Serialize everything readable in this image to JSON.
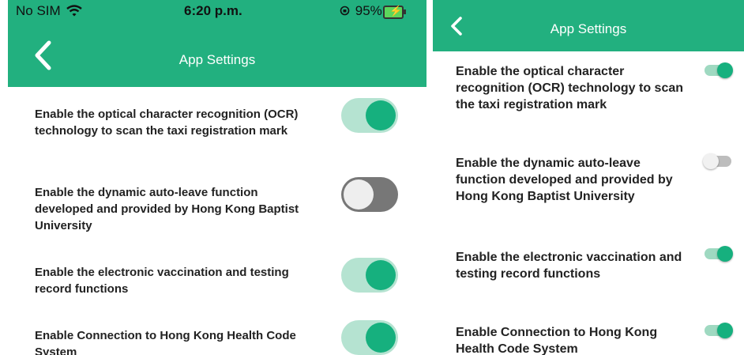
{
  "ios": {
    "status_bar": {
      "carrier": "No SIM",
      "time": "6:20 p.m.",
      "battery": "95%"
    },
    "header": {
      "title": "App Settings"
    },
    "settings": [
      {
        "label": "Enable the optical character recognition (OCR) technology to scan the taxi registration mark",
        "enabled": true
      },
      {
        "label": "Enable the dynamic auto-leave function developed and provided by Hong Kong Baptist University",
        "enabled": false
      },
      {
        "label": "Enable the electronic vaccination and testing record functions",
        "enabled": true
      },
      {
        "label": "Enable Connection to Hong Kong Health Code System",
        "enabled": true
      }
    ]
  },
  "android": {
    "header": {
      "title": "App Settings"
    },
    "settings": [
      {
        "label": "Enable the optical character recognition (OCR) technology to scan the taxi registration mark",
        "enabled": true
      },
      {
        "label": "Enable the dynamic auto-leave function developed and provided by Hong Kong Baptist University",
        "enabled": false
      },
      {
        "label": "Enable the electronic vaccination and testing record functions",
        "enabled": true
      },
      {
        "label": "Enable Connection to Hong Kong Health Code System",
        "enabled": true
      }
    ]
  },
  "colors": {
    "accent": "#22b07f",
    "toggle_on": "#16b07e",
    "toggle_track_on": "#b5e3d1",
    "toggle_track_off": "#777777"
  }
}
